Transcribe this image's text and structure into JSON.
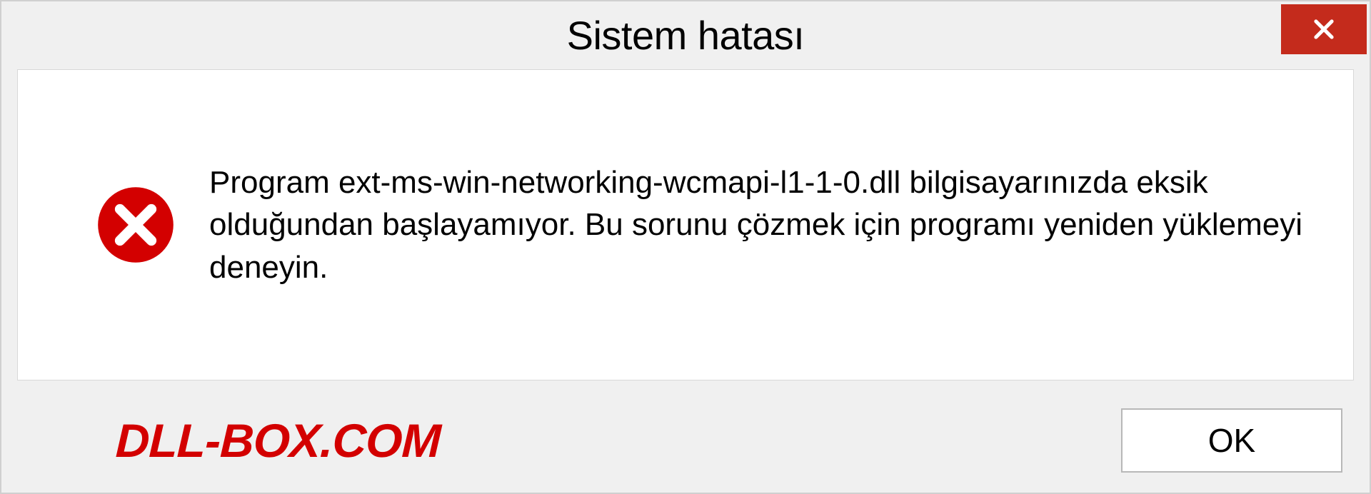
{
  "dialog": {
    "title": "Sistem hatası",
    "message": "Program ext-ms-win-networking-wcmapi-l1-1-0.dll bilgisayarınızda eksik olduğundan başlayamıyor. Bu sorunu çözmek için programı yeniden yüklemeyi deneyin.",
    "ok_label": "OK",
    "watermark": "DLL-BOX.COM"
  },
  "colors": {
    "close_button_bg": "#c42b1c",
    "error_icon_bg": "#d30000",
    "watermark_color": "#d30000"
  }
}
